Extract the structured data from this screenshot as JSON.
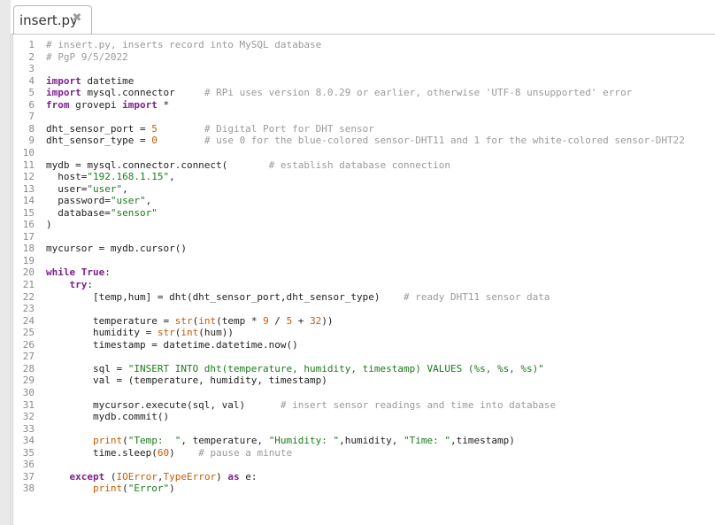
{
  "tab": {
    "label": "insert.py",
    "close": "✖"
  },
  "editor": {
    "lines": [
      [
        [
          "cmt",
          "# insert.py, inserts record into MySQL database"
        ]
      ],
      [
        [
          "cmt",
          "# PgP 9/5/2022"
        ]
      ],
      [],
      [
        [
          "kw",
          "import"
        ],
        [
          "p",
          " datetime"
        ]
      ],
      [
        [
          "kw",
          "import"
        ],
        [
          "p",
          " mysql.connector     "
        ],
        [
          "cmt",
          "# RPi uses version 8.0.29 or earlier, otherwise 'UTF-8 unsupported' error"
        ]
      ],
      [
        [
          "kw",
          "from"
        ],
        [
          "p",
          " grovepi "
        ],
        [
          "kw",
          "import"
        ],
        [
          "p",
          " *"
        ]
      ],
      [],
      [
        [
          "p",
          "dht_sensor_port = "
        ],
        [
          "num",
          "5"
        ],
        [
          "p",
          "        "
        ],
        [
          "cmt",
          "# Digital Port for DHT sensor"
        ]
      ],
      [
        [
          "p",
          "dht_sensor_type = "
        ],
        [
          "num",
          "0"
        ],
        [
          "p",
          "        "
        ],
        [
          "cmt",
          "# use 0 for the blue-colored sensor-DHT11 and 1 for the white-colored sensor-DHT22"
        ]
      ],
      [],
      [
        [
          "p",
          "mydb = mysql.connector.connect(       "
        ],
        [
          "cmt",
          "# establish database connection"
        ]
      ],
      [
        [
          "p",
          "  host="
        ],
        [
          "str",
          "\"192.168.1.15\""
        ],
        [
          "p",
          ","
        ]
      ],
      [
        [
          "p",
          "  user="
        ],
        [
          "str",
          "\"user\""
        ],
        [
          "p",
          ","
        ]
      ],
      [
        [
          "p",
          "  password="
        ],
        [
          "str",
          "\"user\""
        ],
        [
          "p",
          ","
        ]
      ],
      [
        [
          "p",
          "  database="
        ],
        [
          "str",
          "\"sensor\""
        ]
      ],
      [
        [
          "p",
          ")"
        ]
      ],
      [],
      [
        [
          "p",
          "mycursor = mydb.cursor()"
        ]
      ],
      [],
      [
        [
          "kw",
          "while"
        ],
        [
          "p",
          " "
        ],
        [
          "kw",
          "True"
        ],
        [
          "p",
          ":"
        ]
      ],
      [
        [
          "p",
          "    "
        ],
        [
          "kw",
          "try"
        ],
        [
          "p",
          ":"
        ]
      ],
      [
        [
          "p",
          "        [temp,hum] = dht(dht_sensor_port,dht_sensor_type)    "
        ],
        [
          "cmt",
          "# ready DHT11 sensor data"
        ]
      ],
      [],
      [
        [
          "p",
          "        temperature = "
        ],
        [
          "fn",
          "str"
        ],
        [
          "p",
          "("
        ],
        [
          "fn",
          "int"
        ],
        [
          "p",
          "(temp * "
        ],
        [
          "num",
          "9"
        ],
        [
          "p",
          " / "
        ],
        [
          "num",
          "5"
        ],
        [
          "p",
          " + "
        ],
        [
          "num",
          "32"
        ],
        [
          "p",
          "))"
        ]
      ],
      [
        [
          "p",
          "        humidity = "
        ],
        [
          "fn",
          "str"
        ],
        [
          "p",
          "("
        ],
        [
          "fn",
          "int"
        ],
        [
          "p",
          "(hum))"
        ]
      ],
      [
        [
          "p",
          "        timestamp = datetime.datetime.now()"
        ]
      ],
      [],
      [
        [
          "p",
          "        sql = "
        ],
        [
          "str",
          "\"INSERT INTO dht(temperature, humidity, timestamp) VALUES (%s, %s, %s)\""
        ]
      ],
      [
        [
          "p",
          "        val = (temperature, humidity, timestamp)"
        ]
      ],
      [],
      [
        [
          "p",
          "        mycursor.execute(sql, val)      "
        ],
        [
          "cmt",
          "# insert sensor readings and time into database"
        ]
      ],
      [
        [
          "p",
          "        mydb.commit()"
        ]
      ],
      [],
      [
        [
          "p",
          "        "
        ],
        [
          "fn",
          "print"
        ],
        [
          "p",
          "("
        ],
        [
          "str",
          "\"Temp:  \""
        ],
        [
          "p",
          ", temperature, "
        ],
        [
          "str",
          "\"Humidity: \""
        ],
        [
          "p",
          ",humidity, "
        ],
        [
          "str",
          "\"Time: \""
        ],
        [
          "p",
          ",timestamp)"
        ]
      ],
      [
        [
          "p",
          "        time.sleep("
        ],
        [
          "num",
          "60"
        ],
        [
          "p",
          ")    "
        ],
        [
          "cmt",
          "# pause a minute"
        ]
      ],
      [],
      [
        [
          "p",
          "    "
        ],
        [
          "kw",
          "except"
        ],
        [
          "p",
          " ("
        ],
        [
          "fn",
          "IOError"
        ],
        [
          "p",
          ","
        ],
        [
          "fn",
          "TypeError"
        ],
        [
          "p",
          ") "
        ],
        [
          "kw",
          "as"
        ],
        [
          "p",
          " e:"
        ]
      ],
      [
        [
          "p",
          "        "
        ],
        [
          "fn",
          "print"
        ],
        [
          "p",
          "("
        ],
        [
          "str",
          "\"Error\""
        ],
        [
          "p",
          ")"
        ]
      ]
    ]
  }
}
